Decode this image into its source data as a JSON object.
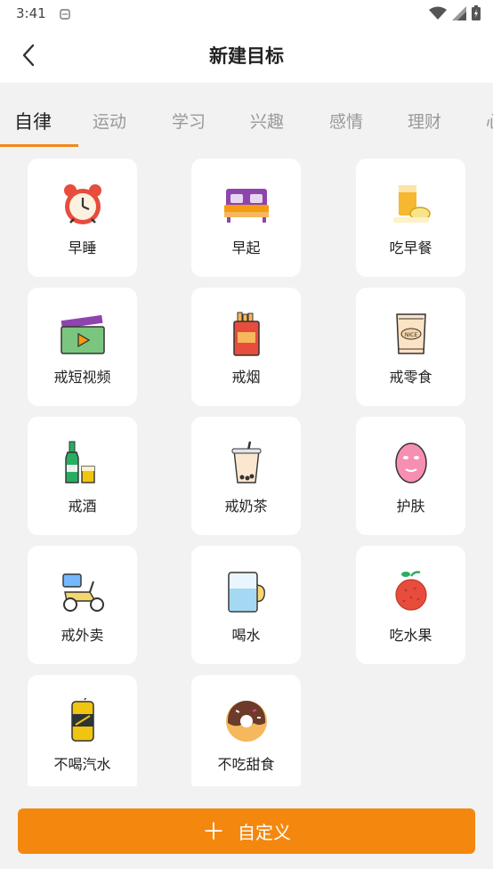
{
  "status": {
    "time": "3:41"
  },
  "header": {
    "title": "新建目标"
  },
  "tabs": [
    {
      "label": "自律"
    },
    {
      "label": "运动"
    },
    {
      "label": "学习"
    },
    {
      "label": "兴趣"
    },
    {
      "label": "感情"
    },
    {
      "label": "理财"
    },
    {
      "label": "心"
    }
  ],
  "goals": [
    {
      "label": "早睡",
      "icon": "alarm-clock-icon"
    },
    {
      "label": "早起",
      "icon": "bed-icon"
    },
    {
      "label": "吃早餐",
      "icon": "breakfast-icon"
    },
    {
      "label": "戒短视频",
      "icon": "clapperboard-icon"
    },
    {
      "label": "戒烟",
      "icon": "cigarette-pack-icon"
    },
    {
      "label": "戒零食",
      "icon": "snack-bag-icon"
    },
    {
      "label": "戒酒",
      "icon": "wine-bottle-icon"
    },
    {
      "label": "戒奶茶",
      "icon": "bubble-tea-icon"
    },
    {
      "label": "护肤",
      "icon": "face-mask-icon"
    },
    {
      "label": "戒外卖",
      "icon": "delivery-scooter-icon"
    },
    {
      "label": "喝水",
      "icon": "water-cup-icon"
    },
    {
      "label": "吃水果",
      "icon": "lychee-icon"
    },
    {
      "label": "不喝汽水",
      "icon": "soda-can-icon"
    },
    {
      "label": "不吃甜食",
      "icon": "donut-icon"
    }
  ],
  "footer": {
    "custom_label": "自定义",
    "accent": "#f4880f"
  }
}
